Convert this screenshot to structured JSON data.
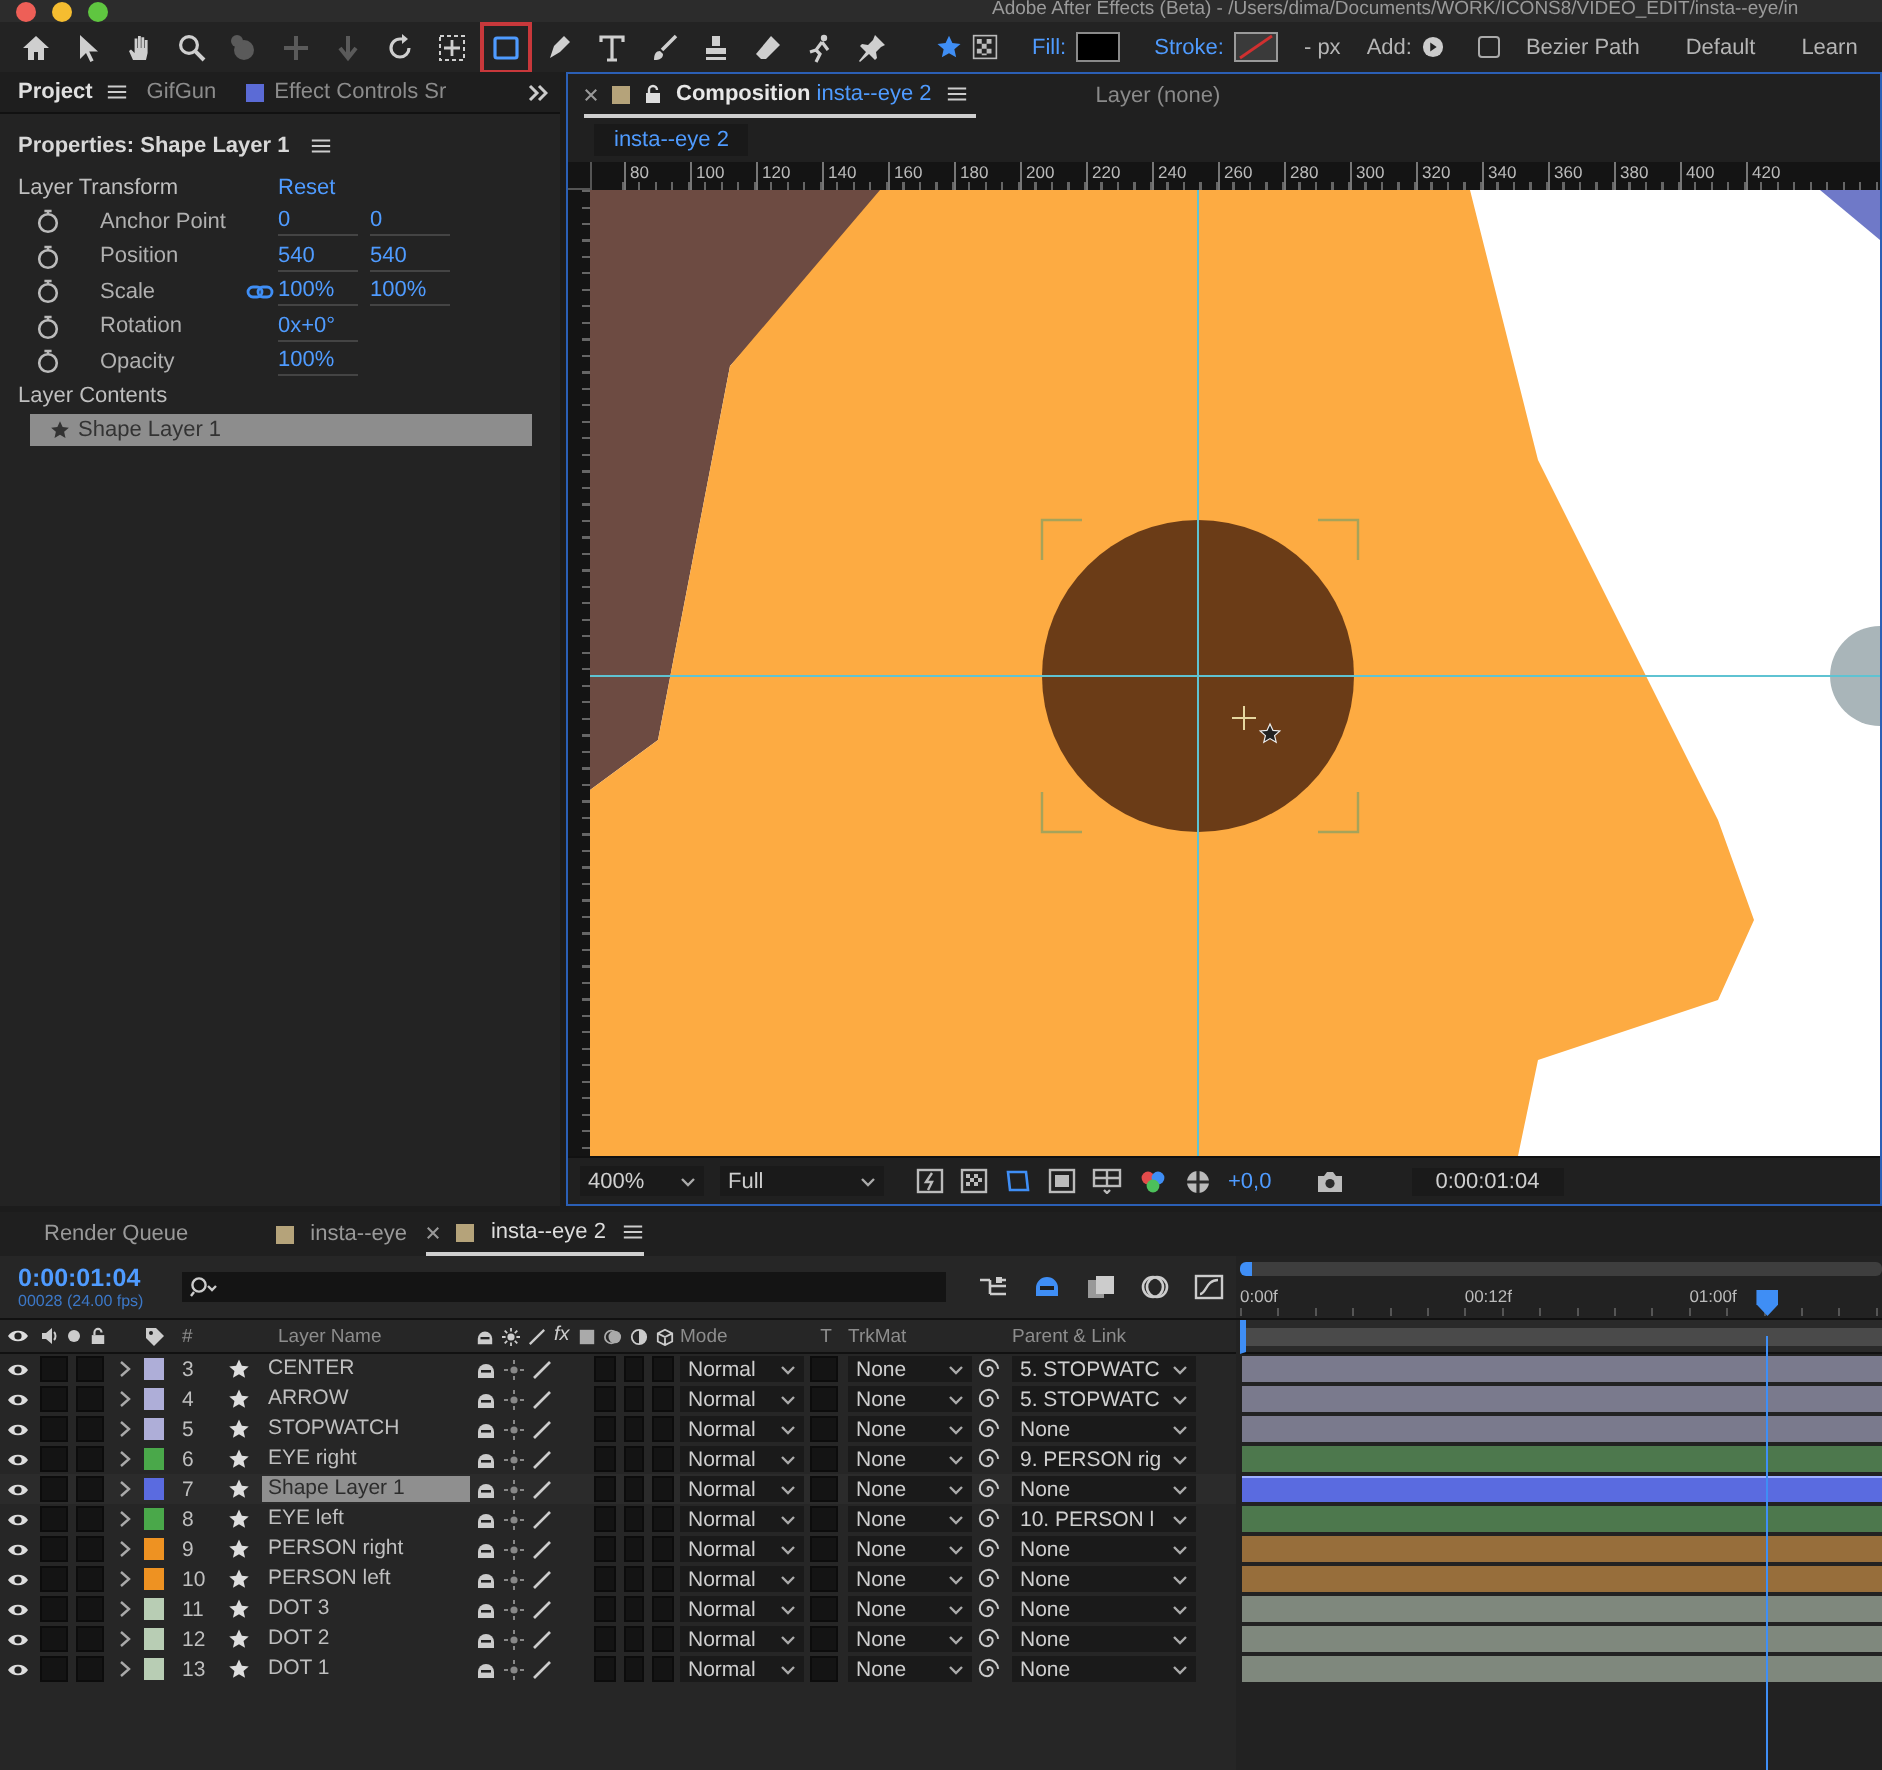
{
  "window": {
    "title": "Adobe After Effects (Beta) - /Users/dima/Documents/WORK/ICONS8/VIDEO_EDIT/insta--eye/in"
  },
  "toolbar": {
    "tools": [
      {
        "kind": "home",
        "selected": false,
        "disabled": false
      },
      {
        "kind": "arrow",
        "selected": false,
        "disabled": false
      },
      {
        "kind": "hand",
        "selected": false,
        "disabled": false
      },
      {
        "kind": "zoom",
        "selected": false,
        "disabled": false
      },
      {
        "kind": "orbit",
        "selected": false,
        "disabled": true
      },
      {
        "kind": "pan",
        "selected": false,
        "disabled": true
      },
      {
        "kind": "dolly",
        "selected": false,
        "disabled": true
      },
      {
        "kind": "rotate",
        "selected": false,
        "disabled": false
      },
      {
        "kind": "anchor",
        "selected": false,
        "disabled": false
      },
      {
        "kind": "rectangle",
        "selected": true,
        "disabled": false
      },
      {
        "kind": "pen",
        "selected": false,
        "disabled": false
      },
      {
        "kind": "text",
        "selected": false,
        "disabled": false
      },
      {
        "kind": "brush",
        "selected": false,
        "disabled": false
      },
      {
        "kind": "stamp",
        "selected": false,
        "disabled": false
      },
      {
        "kind": "eraser",
        "selected": false,
        "disabled": false
      },
      {
        "kind": "roto",
        "selected": false,
        "disabled": false
      },
      {
        "kind": "pin",
        "selected": false,
        "disabled": false
      }
    ],
    "fill_label": "Fill:",
    "stroke_label": "Stroke:",
    "stroke_width": "- px",
    "add_label": "Add:",
    "bezier": {
      "label": "Bezier Path",
      "checked": false
    },
    "workspaces": [
      "Default",
      "Learn"
    ]
  },
  "left_panel": {
    "tabs": [
      {
        "label": "Project",
        "selected": true
      },
      {
        "label": "GifGun",
        "selected": false
      },
      {
        "label": "Effect Controls Sr",
        "selected": false,
        "color": "#5b6bd6"
      }
    ],
    "properties": {
      "title": "Properties: Shape Layer 1",
      "transform_heading": "Layer Transform",
      "reset": "Reset",
      "rows": [
        {
          "label": "Anchor Point",
          "values": [
            "0",
            "0"
          ],
          "linked": false
        },
        {
          "label": "Position",
          "values": [
            "540",
            "540"
          ],
          "linked": false
        },
        {
          "label": "Scale",
          "values": [
            "100%",
            "100%"
          ],
          "linked": true
        },
        {
          "label": "Rotation",
          "values": [
            "0x+0°"
          ],
          "linked": false
        },
        {
          "label": "Opacity",
          "values": [
            "100%"
          ],
          "linked": false
        }
      ],
      "contents_heading": "Layer Contents",
      "contents": [
        {
          "label": "Shape Layer 1",
          "selected": true
        }
      ]
    }
  },
  "composition_panel": {
    "tabs": [
      {
        "label": "Composition",
        "comp_name": "insta--eye 2",
        "selected": true,
        "color": "#b5a37a"
      },
      {
        "label": "Layer (none)",
        "selected": false
      }
    ],
    "breadcrumb": "insta--eye 2",
    "ruler_labels": [
      "80",
      "100",
      "120",
      "140",
      "160",
      "180",
      "200",
      "220",
      "240",
      "260",
      "280",
      "300",
      "320",
      "340",
      "360",
      "380",
      "400",
      "420"
    ],
    "zoom": "400%",
    "resolution": "Full",
    "exposure": "+0,0",
    "timecode": "0:00:01:04"
  },
  "timeline": {
    "tabs": [
      {
        "label": "Render Queue",
        "selected": false
      },
      {
        "label": "insta--eye",
        "selected": false,
        "color": "#b5a37a"
      },
      {
        "label": "insta--eye 2",
        "selected": true,
        "color": "#b5a37a"
      }
    ],
    "timecode": "0:00:01:04",
    "frame_info": "00028 (24.00 fps)",
    "columns": {
      "number": "#",
      "name": "Layer Name",
      "fx": "fx",
      "mode": "Mode",
      "t": "T",
      "trkmat": "TrkMat",
      "parent": "Parent & Link"
    },
    "time_ruler": {
      "labels": [
        "0:00f",
        "00:12f",
        "01:00f"
      ],
      "level": 0.82
    },
    "layers": [
      {
        "number": "3",
        "name": "CENTER",
        "color": "#aeaed8",
        "mode": "Normal",
        "trkmat": "None",
        "parent": "5. STOPWATC",
        "selected": false
      },
      {
        "number": "4",
        "name": "ARROW",
        "color": "#aeaed8",
        "mode": "Normal",
        "trkmat": "None",
        "parent": "5. STOPWATC",
        "selected": false
      },
      {
        "number": "5",
        "name": "STOPWATCH",
        "color": "#aeaed8",
        "mode": "Normal",
        "trkmat": "None",
        "parent": "None",
        "selected": false
      },
      {
        "number": "6",
        "name": "EYE right",
        "color": "#4aa84a",
        "mode": "Normal",
        "trkmat": "None",
        "parent": "9. PERSON rig",
        "selected": false
      },
      {
        "number": "7",
        "name": "Shape Layer 1",
        "color": "#5a6be0",
        "mode": "Normal",
        "trkmat": "None",
        "parent": "None",
        "selected": true
      },
      {
        "number": "8",
        "name": "EYE left",
        "color": "#4aa84a",
        "mode": "Normal",
        "trkmat": "None",
        "parent": "10. PERSON l",
        "selected": false
      },
      {
        "number": "9",
        "name": "PERSON right",
        "color": "#ee9222",
        "mode": "Normal",
        "trkmat": "None",
        "parent": "None",
        "selected": false
      },
      {
        "number": "10",
        "name": "PERSON left",
        "color": "#ee9222",
        "mode": "Normal",
        "trkmat": "None",
        "parent": "None",
        "selected": false
      },
      {
        "number": "11",
        "name": "DOT 3",
        "color": "#b8cdb4",
        "mode": "Normal",
        "trkmat": "None",
        "parent": "None",
        "selected": false
      },
      {
        "number": "12",
        "name": "DOT 2",
        "color": "#b8cdb4",
        "mode": "Normal",
        "trkmat": "None",
        "parent": "None",
        "selected": false
      },
      {
        "number": "13",
        "name": "DOT 1",
        "color": "#b8cdb4",
        "mode": "Normal",
        "trkmat": "None",
        "parent": "None",
        "selected": false
      }
    ]
  }
}
